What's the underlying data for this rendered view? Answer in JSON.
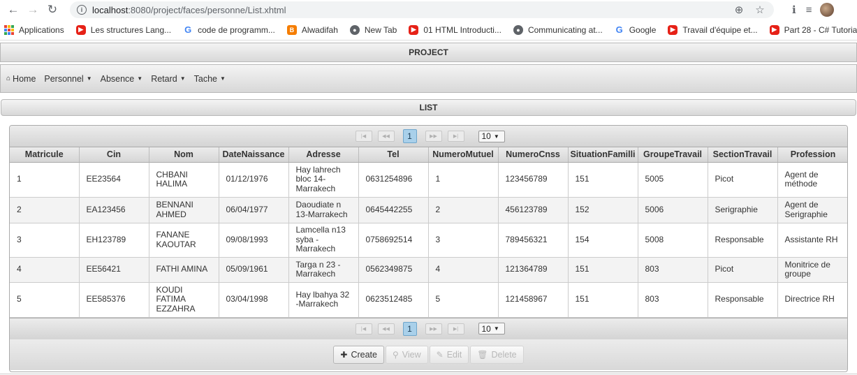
{
  "browser": {
    "url_host": "localhost",
    "url_path": ":8080/project/faces/personne/List.xhtml",
    "bookmarks": [
      {
        "label": "Applications",
        "icon": "apps-icon"
      },
      {
        "label": "Les structures Lang...",
        "icon": "youtube-icon"
      },
      {
        "label": "code de programm...",
        "icon": "google-icon"
      },
      {
        "label": "Alwadifah",
        "icon": "blogger-icon"
      },
      {
        "label": "New Tab",
        "icon": "globe-icon"
      },
      {
        "label": "01 HTML Introducti...",
        "icon": "youtube-icon"
      },
      {
        "label": "Communicating at...",
        "icon": "globe-icon"
      },
      {
        "label": "Google",
        "icon": "google-icon"
      },
      {
        "label": "Travail d'équipe et...",
        "icon": "youtube-icon"
      },
      {
        "label": "Part 28 - C# Tutoria...",
        "icon": "youtube-icon"
      }
    ]
  },
  "app": {
    "title": "PROJECT",
    "menu": {
      "home": "Home",
      "personnel": "Personnel",
      "absence": "Absence",
      "retard": "Retard",
      "tache": "Tache"
    },
    "list_title": "LIST"
  },
  "paginator": {
    "current_page": "1",
    "rows_per_page": "10"
  },
  "table": {
    "columns": [
      "Matricule",
      "Cin",
      "Nom",
      "DateNaissance",
      "Adresse",
      "Tel",
      "NumeroMutuel",
      "NumeroCnss",
      "SituationFamilli",
      "GroupeTravail",
      "SectionTravail",
      "Profession"
    ],
    "rows": [
      [
        "1",
        "EE23564",
        "CHBANI HALIMA",
        "01/12/1976",
        "Hay lahrech bloc 14-Marrakech",
        "0631254896",
        "1",
        "123456789",
        "151",
        "5005",
        "Picot",
        "Agent de méthode"
      ],
      [
        "2",
        "EA123456",
        "BENNANI AHMED",
        "06/04/1977",
        "Daoudiate n 13-Marrakech",
        "0645442255",
        "2",
        "456123789",
        "152",
        "5006",
        "Serigraphie",
        "Agent de Serigraphie"
      ],
      [
        "3",
        "EH123789",
        "FANANE KAOUTAR",
        "09/08/1993",
        "Lamcella n13 syba - Marrakech",
        "0758692514",
        "3",
        "789456321",
        "154",
        "5008",
        "Responsable",
        "Assistante RH"
      ],
      [
        "4",
        "EE56421",
        "FATHI AMINA",
        "05/09/1961",
        "Targa n 23 - Marrakech",
        "0562349875",
        "4",
        "121364789",
        "151",
        "803",
        "Picot",
        "Monitrice de groupe"
      ],
      [
        "5",
        "EE585376",
        "KOUDI FATIMA EZZAHRA",
        "03/04/1998",
        "Hay lbahya 32 -Marrakech",
        "0623512485",
        "5",
        "121458967",
        "151",
        "803",
        "Responsable",
        "Directrice RH"
      ]
    ]
  },
  "actions": {
    "create": "Create",
    "view": "View",
    "edit": "Edit",
    "delete": "Delete"
  }
}
